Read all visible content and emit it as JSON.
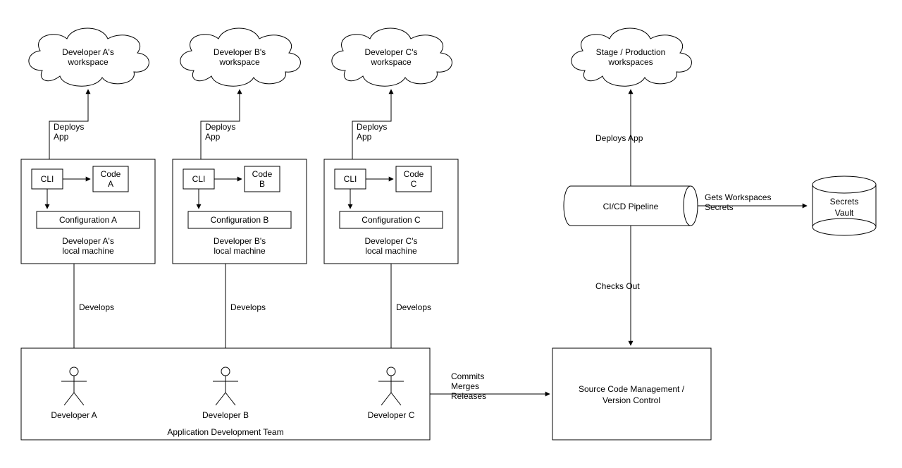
{
  "clouds": {
    "a": {
      "line1": "Developer A's",
      "line2": "workspace"
    },
    "b": {
      "line1": "Developer B's",
      "line2": "workspace"
    },
    "c": {
      "line1": "Developer C's",
      "line2": "workspace"
    },
    "stage": {
      "line1": "Stage / Production",
      "line2": "workspaces"
    }
  },
  "edges": {
    "deploysA": {
      "l1": "Deploys",
      "l2": "App"
    },
    "deploysB": {
      "l1": "Deploys",
      "l2": "App"
    },
    "deploysC": {
      "l1": "Deploys",
      "l2": "App"
    },
    "deploysStage": "Deploys App",
    "developsA": "Develops",
    "developsB": "Develops",
    "developsC": "Develops",
    "commits": {
      "l1": "Commits",
      "l2": "Merges",
      "l3": "Releases"
    },
    "checks": "Checks Out",
    "secrets": {
      "l1": "Gets Workspaces",
      "l2": "Secrets"
    }
  },
  "machines": {
    "a": {
      "cli": "CLI",
      "code1": "Code",
      "code2": "A",
      "config": "Configuration A",
      "label1": "Developer A's",
      "label2": "local machine"
    },
    "b": {
      "cli": "CLI",
      "code1": "Code",
      "code2": "B",
      "config": "Configuration B",
      "label1": "Developer B's",
      "label2": "local machine"
    },
    "c": {
      "cli": "CLI",
      "code1": "Code",
      "code2": "C",
      "config": "Configuration C",
      "label1": "Developer C's",
      "label2": "local machine"
    }
  },
  "actors": {
    "a": "Developer A",
    "b": "Developer B",
    "c": "Developer C"
  },
  "team": "Application Development Team",
  "pipeline": "CI/CD Pipeline",
  "scm": {
    "l1": "Source Code Management /",
    "l2": "Version Control"
  },
  "vault": {
    "l1": "Secrets",
    "l2": "Vault"
  }
}
